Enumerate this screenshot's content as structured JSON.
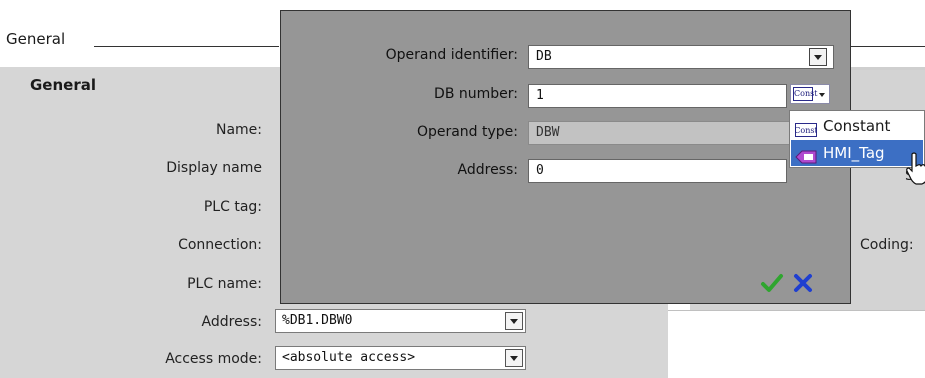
{
  "section": {
    "title": "General"
  },
  "panel": {
    "heading": "General",
    "labels": {
      "name": "Name:",
      "display_name": "Display name",
      "plc_tag": "PLC tag:",
      "connection": "Connection:",
      "plc_name": "PLC name:",
      "address": "Address:",
      "access_mode": "Access mode:"
    },
    "address_value": "%DB1.DBW0",
    "access_mode_value": "<absolute access>",
    "coding_label": "Coding:",
    "right_partial_text": "S"
  },
  "dialog": {
    "operand_identifier_label": "Operand identifier:",
    "operand_identifier_value": "DB",
    "db_number_label": "DB number:",
    "db_number_value": "1",
    "operand_type_label": "Operand type:",
    "operand_type_value": "DBW",
    "address_label": "Address:",
    "address_value": "0",
    "const_button_icon": "Const",
    "ok_icon": "green-checkmark",
    "cancel_icon": "blue-x"
  },
  "popup": {
    "items": [
      {
        "label": "Constant",
        "icon": "Const",
        "selected": false
      },
      {
        "label": "HMI_Tag",
        "icon": "hmi-tag-icon",
        "selected": true
      }
    ]
  },
  "colors": {
    "dialog_bg": "#969696",
    "panel_bg": "#d6d6d6",
    "selection": "#3c6fc4",
    "ok_green": "#2fa52f",
    "cancel_blue": "#1f3fd0"
  }
}
